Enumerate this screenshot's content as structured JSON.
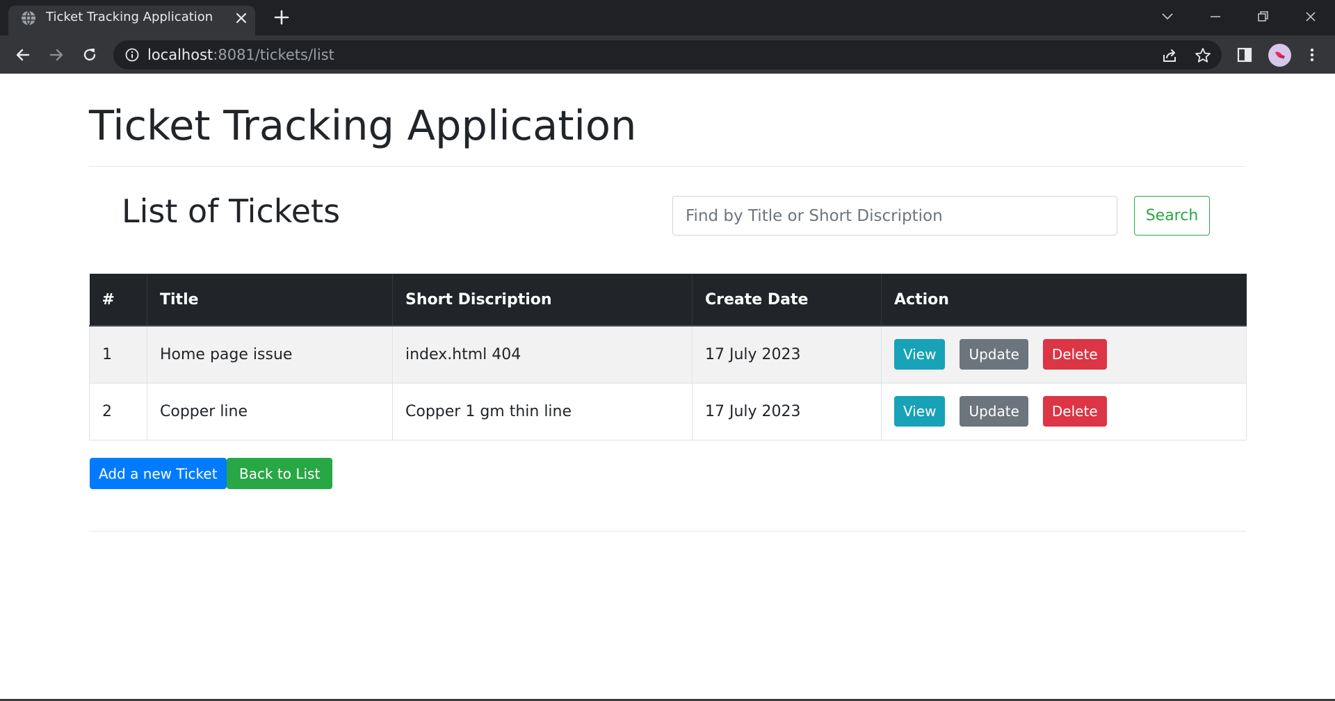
{
  "browser": {
    "tab_title": "Ticket Tracking Application",
    "url_host": "localhost",
    "url_rest": ":8081/tickets/list"
  },
  "page": {
    "title": "Ticket Tracking Application",
    "section_title": "List of Tickets",
    "search": {
      "placeholder": "Find by Title or Short Discription",
      "button_label": "Search"
    },
    "table": {
      "headers": [
        "#",
        "Title",
        "Short Discription",
        "Create Date",
        "Action"
      ],
      "rows": [
        {
          "num": "1",
          "title": "Home page issue",
          "description": "index.html 404",
          "date": "17 July 2023"
        },
        {
          "num": "2",
          "title": "Copper line",
          "description": "Copper 1 gm thin line",
          "date": "17 July 2023"
        }
      ],
      "actions": {
        "view": "View",
        "update": "Update",
        "delete": "Delete"
      }
    },
    "add_button": "Add a new Ticket",
    "back_button": "Back to List"
  },
  "colors": {
    "primary": "#007bff",
    "success": "#28a745",
    "info": "#17a2b8",
    "secondary": "#6c757d",
    "danger": "#dc3545",
    "dark": "#212529"
  },
  "icons": [
    "globe-icon",
    "close-icon",
    "plus-icon",
    "chevron-down-icon",
    "minimize-icon",
    "restore-icon",
    "window-close-icon",
    "back-icon",
    "forward-icon",
    "reload-icon",
    "info-icon",
    "share-icon",
    "star-icon",
    "side-panel-icon",
    "kebab-menu-icon"
  ]
}
